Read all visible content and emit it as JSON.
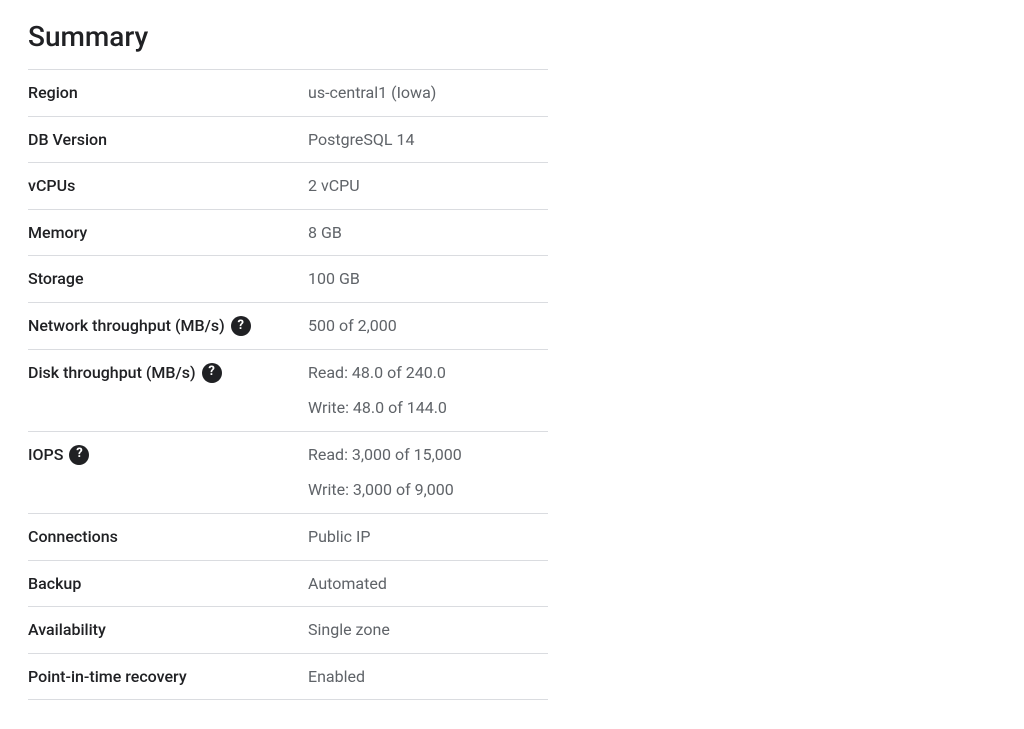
{
  "summary": {
    "title": "Summary",
    "rows": {
      "region": {
        "label": "Region",
        "value": "us-central1 (Iowa)"
      },
      "db_version": {
        "label": "DB Version",
        "value": "PostgreSQL 14"
      },
      "vcpus": {
        "label": "vCPUs",
        "value": "2 vCPU"
      },
      "memory": {
        "label": "Memory",
        "value": "8 GB"
      },
      "storage": {
        "label": "Storage",
        "value": "100 GB"
      },
      "network_throughput": {
        "label": "Network throughput (MB/s)",
        "value": "500 of 2,000"
      },
      "disk_throughput": {
        "label": "Disk throughput (MB/s)",
        "read": "Read: 48.0 of 240.0",
        "write": "Write: 48.0 of 144.0"
      },
      "iops": {
        "label": "IOPS",
        "read": "Read: 3,000 of 15,000",
        "write": "Write: 3,000 of 9,000"
      },
      "connections": {
        "label": "Connections",
        "value": "Public IP"
      },
      "backup": {
        "label": "Backup",
        "value": "Automated"
      },
      "availability": {
        "label": "Availability",
        "value": "Single zone"
      },
      "pitr": {
        "label": "Point-in-time recovery",
        "value": "Enabled"
      }
    },
    "help_glyph": "?"
  }
}
